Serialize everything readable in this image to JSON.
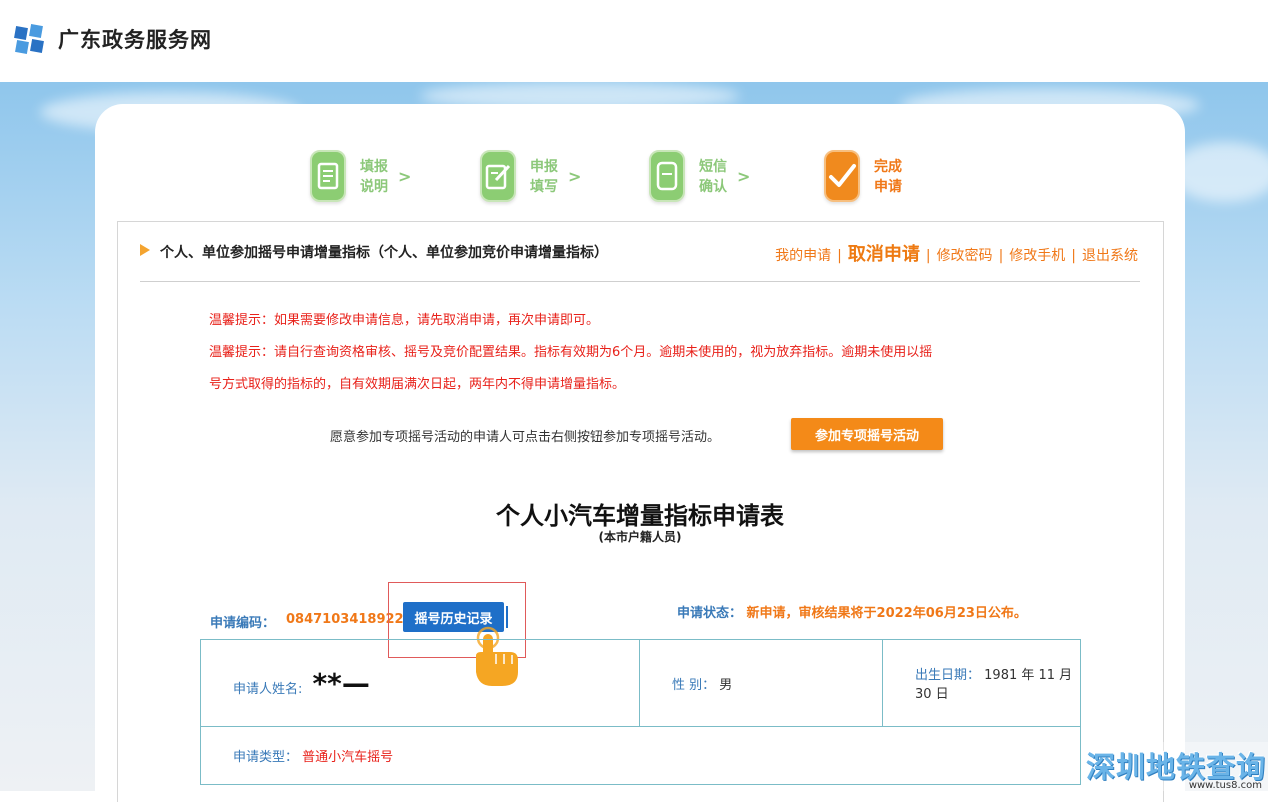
{
  "site": {
    "title": "广东政务服务网"
  },
  "steps": [
    {
      "label": "填报说明",
      "icon": "document-icon"
    },
    {
      "label": "申报填写",
      "icon": "edit-icon"
    },
    {
      "label": "短信确认",
      "icon": "phone-icon"
    },
    {
      "label": "完成申请",
      "icon": "checkmark-icon"
    }
  ],
  "header": {
    "title": "个人、单位参加摇号申请增量指标（个人、单位参加竞价申请增量指标）",
    "links": {
      "my_application": "我的申请",
      "cancel_application": "取消申请",
      "change_password": "修改密码",
      "change_phone": "修改手机",
      "logout": "退出系统"
    }
  },
  "tips": {
    "tip1": "温馨提示：如果需要修改申请信息，请先取消申请，再次申请即可。",
    "tip2_line1": "温馨提示：请自行查询资格审核、摇号及竞价配置结果。指标有效期为6个月。逾期未使用的，视为放弃指标。逾期未使用以摇",
    "tip2_line2": "号方式取得的指标的，自有效期届满次日起，两年内不得申请增量指标。"
  },
  "special": {
    "text": "愿意参加专项摇号活动的申请人可点击右侧按钮参加专项摇号活动。",
    "button": "参加专项摇号活动"
  },
  "form": {
    "title": "个人小汽车增量指标申请表",
    "subtitle": "(本市户籍人员)",
    "code_label": "申请编码：",
    "code_value": "0847103418922",
    "history_button": "摇号历史记录",
    "status_label": "申请状态：",
    "status_value": "新申请，审核结果将于2022年06月23日公布。",
    "name_label": "申请人姓名:",
    "name_value": "**—",
    "gender_label": "性 别：",
    "gender_value": "男",
    "birth_label": "出生日期：",
    "birth_value": "1981 年 11 月 30 日",
    "type_label": "申请类型：",
    "type_value": "普通小汽车摇号"
  },
  "watermark": {
    "main": "深圳地铁查询",
    "url": "www.tus8.com"
  },
  "colors": {
    "orange": "#f07818",
    "blue": "#1f6fc8",
    "green": "#8ccd73",
    "red": "#e8211a"
  }
}
